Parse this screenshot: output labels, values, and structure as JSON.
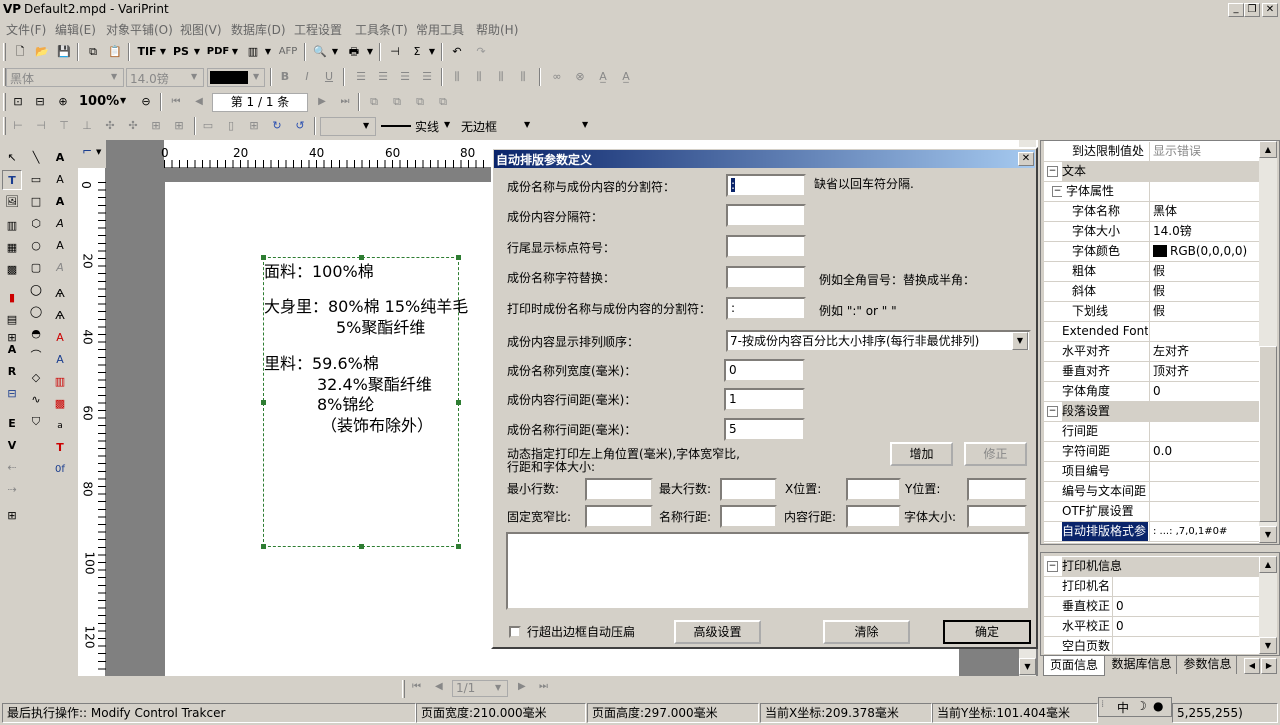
{
  "window": {
    "icon": "VP",
    "title": "Default2.mpd - VariPrint"
  },
  "menu": [
    "文件(F)",
    "编辑(E)",
    "对象平铺(O)",
    "视图(V)",
    "数据库(D)",
    "工程设置",
    "工具条(T)",
    "常用工具",
    "帮助(H)"
  ],
  "toolbar1": {
    "tif": "TIF",
    "ps": "PS",
    "pdf": "PDF",
    "afp": "AFP"
  },
  "font_toolbar": {
    "font_name": "黑体",
    "font_size": "14.0镑",
    "color": "#000000"
  },
  "nav_toolbar": {
    "zoom": "100%",
    "page": "第 1 / 1 条"
  },
  "line_toolbar": {
    "line_style": "实线",
    "border": "无边框"
  },
  "ruler": {
    "h_ticks": [
      "0",
      "20",
      "40",
      "60",
      "80"
    ],
    "v_ticks": [
      "0",
      "20",
      "40",
      "60",
      "80",
      "100",
      "120"
    ]
  },
  "canvas_text": {
    "line1": "面料：100%棉",
    "line2": "大身里：80%棉 15%纯羊毛",
    "line3": "5%聚酯纤维",
    "line4": "里料：59.6%棉",
    "line5": "32.4%聚酯纤维",
    "line6": "8%锦纶",
    "line7": "（装饰布除外）"
  },
  "dialog": {
    "title": "自动排版参数定义",
    "sep_label": "成份名称与成份内容的分割符：",
    "sep_value": ":",
    "sep_hint": "缺省以回车符分隔.",
    "content_sep_label": "成份内容分隔符：",
    "content_sep_value": "",
    "eol_label": "行尾显示标点符号：",
    "eol_value": "",
    "replace_label": "成份名称字符替换：",
    "replace_value": "",
    "replace_hint": "例如全角冒号：替换成半角：",
    "print_sep_label": "打印时成份名称与成份内容的分割符：",
    "print_sep_value": ":",
    "print_sep_hint": "例如  \":\" or \" \"",
    "order_label": "成份内容显示排列顺序：",
    "order_value": "7-按成份内容百分比大小排序(每行非最优排列)",
    "col_width_label": "成份名称列宽度(毫米)：",
    "col_width_value": "0",
    "content_spacing_label": "成份内容行间距(毫米)：",
    "content_spacing_value": "1",
    "name_spacing_label": "成份名称行间距(毫米)：",
    "name_spacing_value": "5",
    "dynamic_label_1": "动态指定打印左上角位置(毫米),字体宽窄比,",
    "dynamic_label_2": "行距和字体大小:",
    "add_button": "增加",
    "modify_button": "修正",
    "min_rows": "最小行数:",
    "max_rows": "最大行数:",
    "x_pos": "X位置:",
    "y_pos": "Y位置:",
    "fixed_ratio": "固定宽窄比:",
    "name_spacing": "名称行距:",
    "content_spacing": "内容行距:",
    "font_size": "字体大小:",
    "overflow_checkbox": "行超出边框自动压扁",
    "advanced_button": "高级设置",
    "clear_button": "清除",
    "ok_button": "确定"
  },
  "props": {
    "rows": [
      {
        "k": "到达限制值处",
        "v": "显示错误",
        "group": false,
        "indent": true
      },
      {
        "k": "文本",
        "v": "",
        "group": true
      },
      {
        "k": "字体属性",
        "v": "",
        "group": false,
        "exp": true
      },
      {
        "k": "字体名称",
        "v": "黑体",
        "group": false,
        "indent": true
      },
      {
        "k": "字体大小",
        "v": "14.0镑",
        "group": false,
        "indent": true
      },
      {
        "k": "字体颜色",
        "v": "RGB(0,0,0,0)",
        "group": false,
        "indent": true,
        "swatch": true
      },
      {
        "k": "粗体",
        "v": "假",
        "group": false,
        "indent": true
      },
      {
        "k": "斜体",
        "v": "假",
        "group": false,
        "indent": true
      },
      {
        "k": "下划线",
        "v": "假",
        "group": false,
        "indent": true
      },
      {
        "k": "Extended Font St",
        "v": "",
        "group": false
      },
      {
        "k": "水平对齐",
        "v": "左对齐",
        "group": false
      },
      {
        "k": "垂直对齐",
        "v": "顶对齐",
        "group": false
      },
      {
        "k": "字体角度",
        "v": "0",
        "group": false
      },
      {
        "k": "段落设置",
        "v": "",
        "group": true
      },
      {
        "k": "行间距",
        "v": "",
        "group": false
      },
      {
        "k": "字符间距",
        "v": "0.0",
        "group": false
      },
      {
        "k": "项目编号",
        "v": "",
        "group": false
      },
      {
        "k": "编号与文本间距",
        "v": "",
        "group": false
      },
      {
        "k": "OTF扩展设置",
        "v": "",
        "group": false
      },
      {
        "k": "自动排版格式参",
        "v": ": ...: ,7,0,1#0#",
        "group": false,
        "selected": true
      }
    ],
    "printer_title": "打印机信息",
    "printer_rows": [
      {
        "k": "打印机名",
        "v": ""
      },
      {
        "k": "垂直校正",
        "v": "0"
      },
      {
        "k": "水平校正",
        "v": "0"
      },
      {
        "k": "空白页数",
        "v": ""
      }
    ],
    "tabs": [
      "页面信息",
      "数据库信息",
      "参数信息"
    ]
  },
  "bottom_nav": {
    "page": "1/1"
  },
  "ime": {
    "mode": "中"
  },
  "status": {
    "last_op": "最后执行操作:: Modify Control Trakcer",
    "page_width": "页面宽度:210.000毫米",
    "page_height": "页面高度:297.000毫米",
    "cur_x": "当前X坐标:209.378毫米",
    "cur_y": "当前Y坐标:101.404毫米",
    "color": "5,255,255)"
  }
}
